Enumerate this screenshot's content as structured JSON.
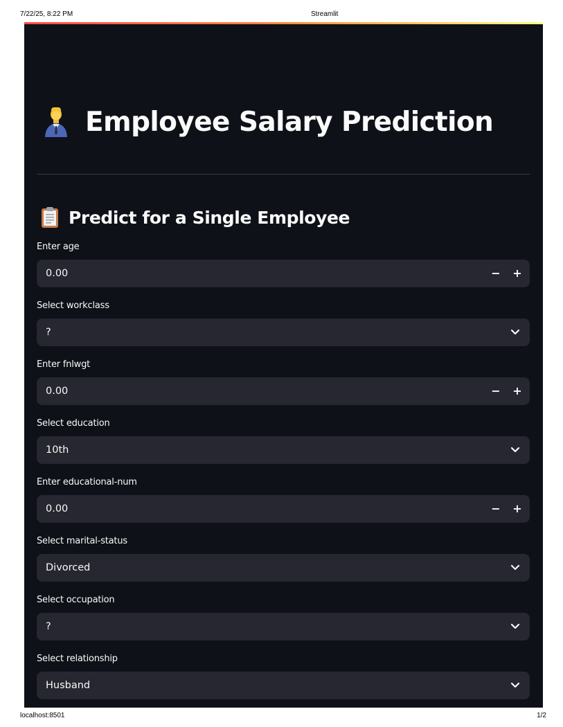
{
  "print_header": {
    "date": "7/22/25, 8:22 PM",
    "title": "Streamlit"
  },
  "print_footer": {
    "url": "localhost:8501",
    "page": "1/2"
  },
  "title": {
    "icon": "office-worker-emoji",
    "text": "Employee Salary Prediction"
  },
  "section": {
    "icon": "clipboard-emoji",
    "text": "Predict for a Single Employee"
  },
  "fields": [
    {
      "label": "Enter age",
      "type": "number",
      "value": "0.00",
      "minus": "−",
      "plus": "+"
    },
    {
      "label": "Select workclass",
      "type": "select",
      "value": "?"
    },
    {
      "label": "Enter fnlwgt",
      "type": "number",
      "value": "0.00",
      "minus": "−",
      "plus": "+"
    },
    {
      "label": "Select education",
      "type": "select",
      "value": "10th"
    },
    {
      "label": "Enter educational-num",
      "type": "number",
      "value": "0.00",
      "minus": "−",
      "plus": "+"
    },
    {
      "label": "Select marital-status",
      "type": "select",
      "value": "Divorced"
    },
    {
      "label": "Select occupation",
      "type": "select",
      "value": "?"
    },
    {
      "label": "Select relationship",
      "type": "select",
      "value": "Husband"
    }
  ],
  "colors": {
    "app_background": "#0e1117",
    "input_background": "#262730",
    "text": "#fafafa",
    "divider": "#3a3d46",
    "accent_gradient": [
      "#ff4b4b",
      "#ff8a3d",
      "#fffd80"
    ]
  }
}
